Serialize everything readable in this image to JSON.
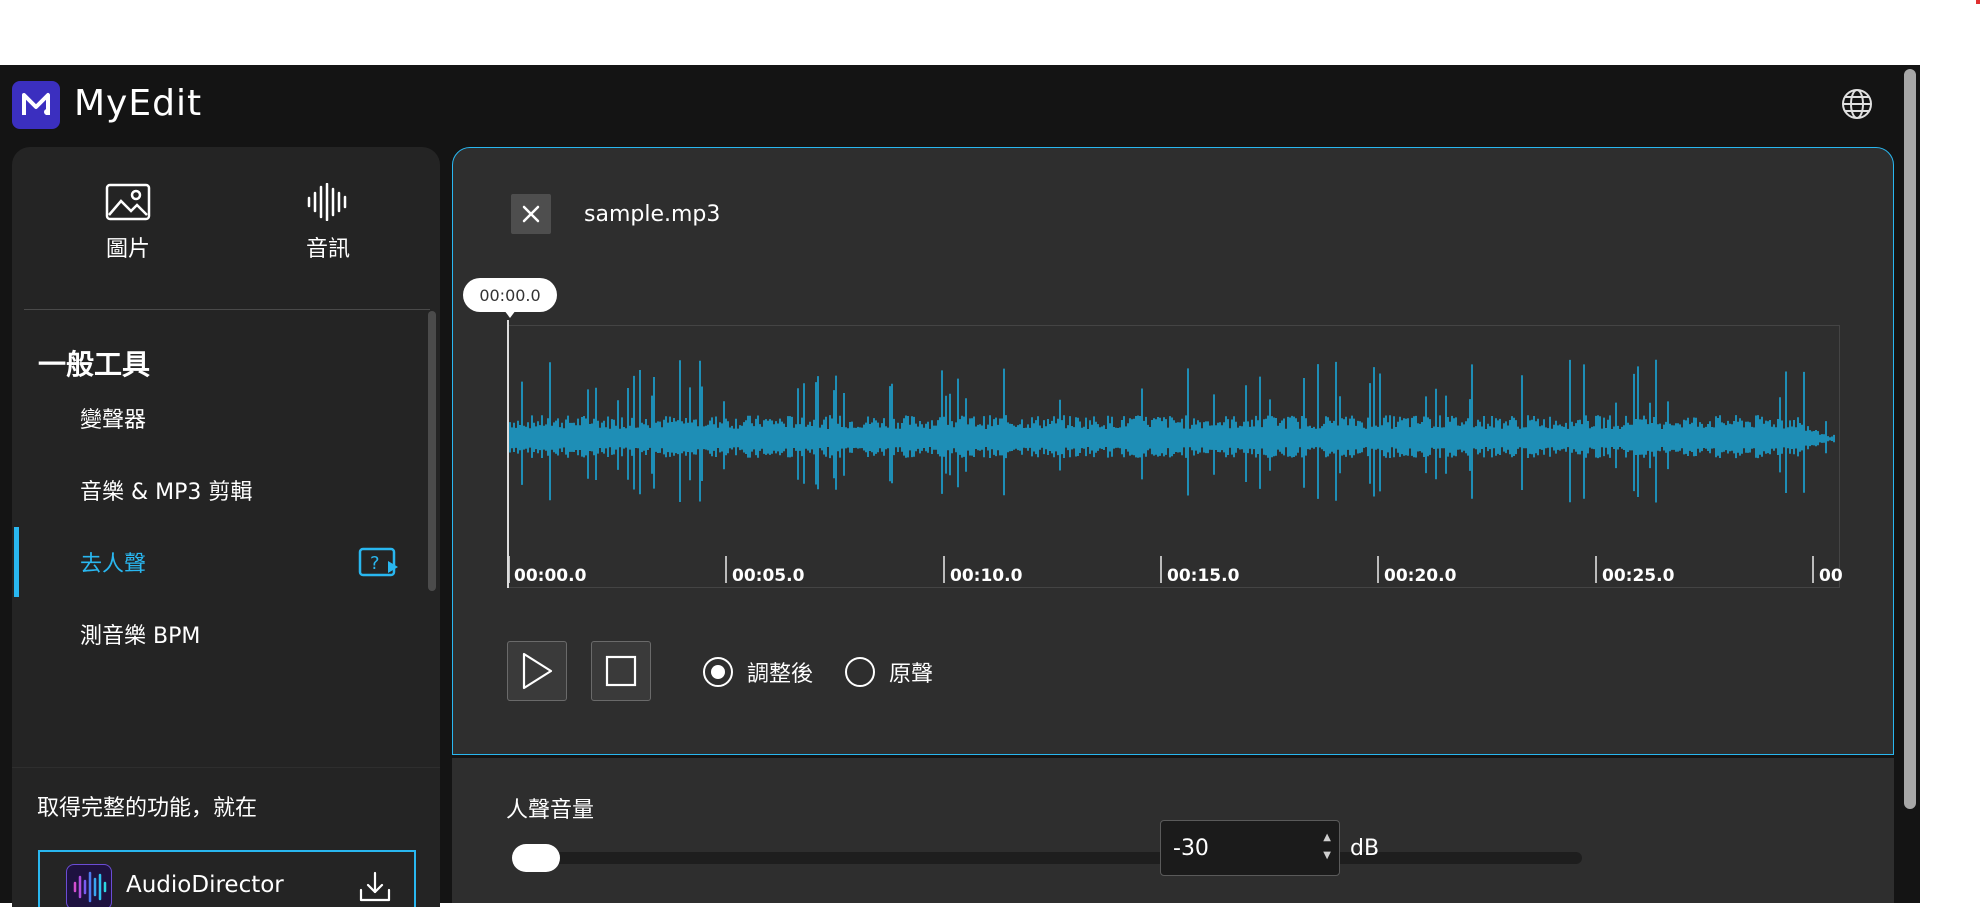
{
  "app": {
    "name": "MyEdit"
  },
  "header": {
    "globe_icon": "globe-icon"
  },
  "sidebar": {
    "categories": [
      {
        "label": "圖片",
        "icon": "image-icon"
      },
      {
        "label": "音訊",
        "icon": "audio-wave-icon"
      }
    ],
    "section_title": "一般工具",
    "items": [
      {
        "label": "變聲器"
      },
      {
        "label": "音樂 & MP3 剪輯"
      },
      {
        "label": "去人聲",
        "active": true
      },
      {
        "label": "測音樂 BPM"
      }
    ],
    "promo": {
      "text": "取得完整的功能，就在",
      "app_label": "AudioDirector"
    }
  },
  "editor": {
    "filename": "sample.mp3",
    "current_time": "00:00.0",
    "timeline_ticks": [
      "00:00.0",
      "00:05.0",
      "00:10.0",
      "00:15.0",
      "00:20.0",
      "00:25.0",
      "00"
    ],
    "waveform_color": "#1aa6d8",
    "playback": {
      "play_icon": "play-icon",
      "stop_icon": "stop-icon",
      "options": [
        {
          "label": "調整後",
          "selected": true
        },
        {
          "label": "原聲",
          "selected": false
        }
      ]
    }
  },
  "vocal_volume": {
    "label": "人聲音量",
    "value": "-30",
    "unit": "dB"
  },
  "colors": {
    "accent": "#29b7f0",
    "brand": "#3b2fbf"
  }
}
